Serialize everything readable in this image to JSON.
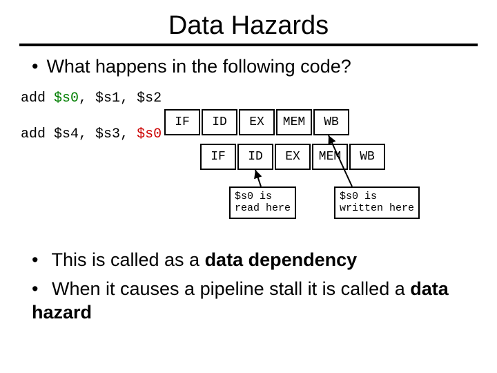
{
  "title": "Data Hazards",
  "q": "What happens in the following code?",
  "code": {
    "l1_op": "add ",
    "l1_rd": "$s0",
    "l1_sep1": ", ",
    "l1_rs": "$s1",
    "l1_sep2": ", ",
    "l1_rt": "$s2",
    "l2_op": "add ",
    "l2_rd": "$s4",
    "l2_sep1": ", ",
    "l2_rs": "$s3",
    "l2_sep2": ", ",
    "l2_rt": "$s0"
  },
  "stages": {
    "IF": "IF",
    "ID": "ID",
    "EX": "EX",
    "MEM": "MEM",
    "WB": "WB"
  },
  "anno": {
    "read": "$s0 is\nread here",
    "write": "$s0 is\nwritten here"
  },
  "b1a": "This is called as a ",
  "b1b": "data dependency",
  "b2a": "When it causes a pipeline stall it is called a ",
  "b2b": "data hazard"
}
